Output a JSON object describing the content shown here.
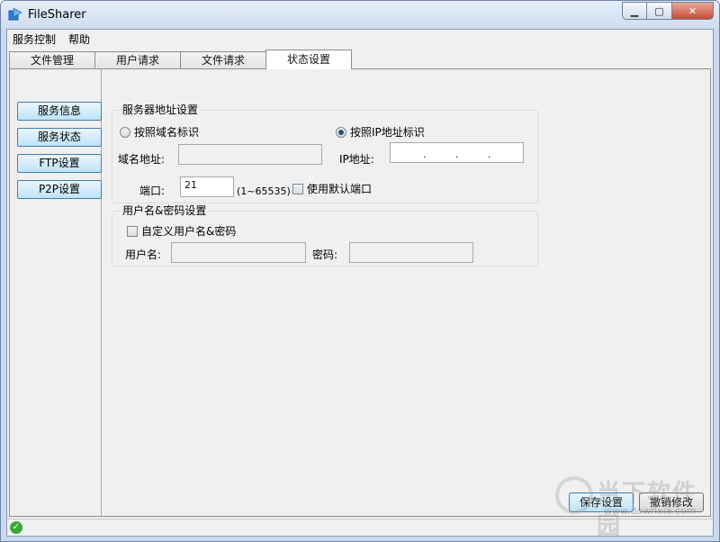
{
  "window": {
    "title": "FileSharer",
    "min_icon": "minimize-icon",
    "max_icon": "maximize-icon",
    "close_icon": "close-icon"
  },
  "menu": {
    "items": [
      "服务控制",
      "帮助"
    ]
  },
  "tabs": [
    {
      "label": "文件管理",
      "active": false
    },
    {
      "label": "用户请求",
      "active": false
    },
    {
      "label": "文件请求",
      "active": false
    },
    {
      "label": "状态设置",
      "active": true
    }
  ],
  "sidebar": {
    "buttons": [
      "服务信息",
      "服务状态",
      "FTP设置",
      "P2P设置"
    ]
  },
  "server_address": {
    "group_title": "服务器地址设置",
    "radio_domain_label": "按照域名标识",
    "radio_ip_label": "按照IP地址标识",
    "selected": "ip",
    "domain_label": "域名地址:",
    "domain_value": "",
    "ip_label": "IP地址:",
    "ip_separator": ".",
    "port_label": "端口:",
    "port_value": "21",
    "port_range": "(1~65535)",
    "default_port_label": "使用默认端口"
  },
  "credentials": {
    "group_title": "用户名&密码设置",
    "custom_label": "自定义用户名&密码",
    "username_label": "用户名:",
    "password_label": "密码:"
  },
  "actions": {
    "save": "保存设置",
    "cancel": "撤销修改"
  },
  "watermark": {
    "text": "当下软件园",
    "url": "www.downxia.com"
  }
}
